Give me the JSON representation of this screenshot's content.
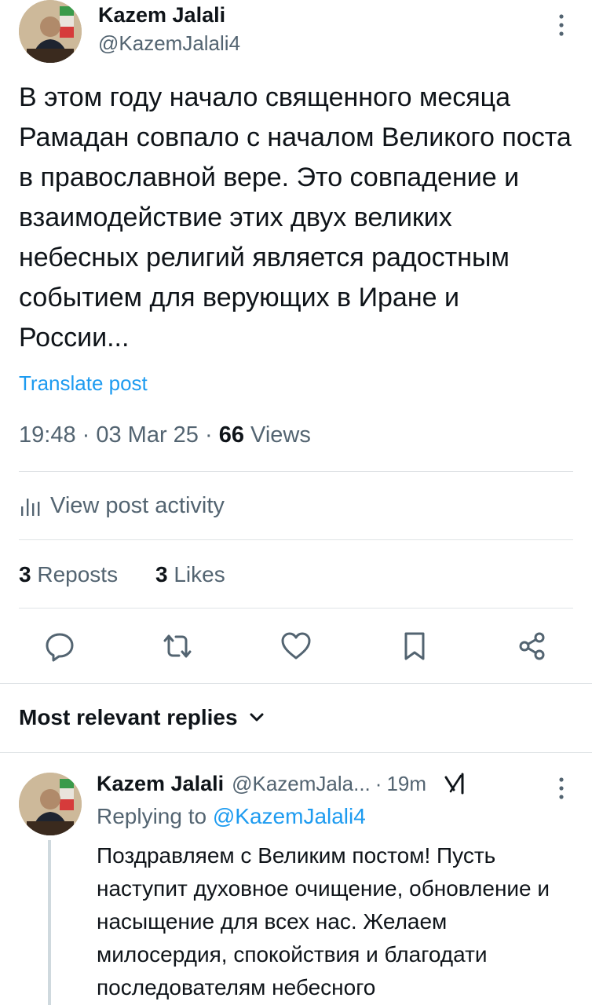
{
  "post": {
    "author_name": "Kazem Jalali",
    "author_handle": "@KazemJalali4",
    "text": "В этом году начало священного месяца Рамадан совпало с началом Великого поста в православной вере. Это совпадение и взаимодействие этих двух великих небесных религий является радостным событием для верующих в Иране и России...",
    "translate_label": "Translate post",
    "time": "19:48",
    "date": "03 Mar 25",
    "views_count": "66",
    "views_label": "Views",
    "activity_label": "View post activity",
    "reposts_count": "3",
    "reposts_label": "Reposts",
    "likes_count": "3",
    "likes_label": "Likes"
  },
  "actions": {
    "icons": [
      "reply-icon",
      "repost-icon",
      "like-icon",
      "bookmark-icon",
      "share-icon"
    ]
  },
  "replies_header": {
    "label": "Most relevant replies"
  },
  "reply": {
    "author_name": "Kazem Jalali",
    "author_handle": "@KazemJala...",
    "time": "19m",
    "replying_prefix": "Replying to",
    "replying_handle": "@KazemJalali4",
    "text": "Поздравляем с Великим постом! Пусть наступит духовное очищение, обновление и насыщение для всех нас. Желаем милосердия, спокойствия и благодати последователям небесного"
  },
  "colors": {
    "link": "#1d9bf0",
    "secondary_text": "#536471",
    "primary_text": "#0f1419",
    "divider": "#dfe3e6"
  }
}
